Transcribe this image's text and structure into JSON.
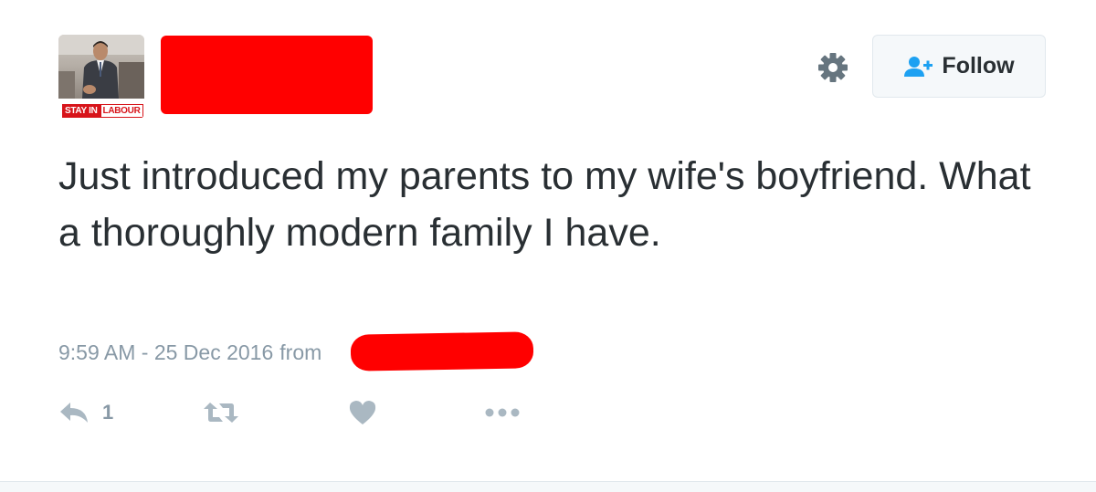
{
  "header": {
    "avatar_badge_left": "STAY IN",
    "avatar_badge_right": "LABOUR",
    "follow_label": "Follow",
    "gear_icon": "gear-icon",
    "follow_icon": "add-user-icon"
  },
  "tweet": {
    "text": "Just introduced my parents to my wife's boyfriend. What a thoroughly modern family I have.",
    "timestamp": "9:59 AM - 25 Dec 2016",
    "from_label": "from"
  },
  "actions": {
    "reply_icon": "reply-icon",
    "reply_count": "1",
    "retweet_icon": "retweet-icon",
    "like_icon": "heart-icon",
    "more_icon": "more-dots-icon"
  },
  "colors": {
    "text": "#292f33",
    "muted": "#8899a6",
    "link": "#3b94d9",
    "follow_icon": "#1da1f2",
    "redaction": "#ff0000"
  }
}
